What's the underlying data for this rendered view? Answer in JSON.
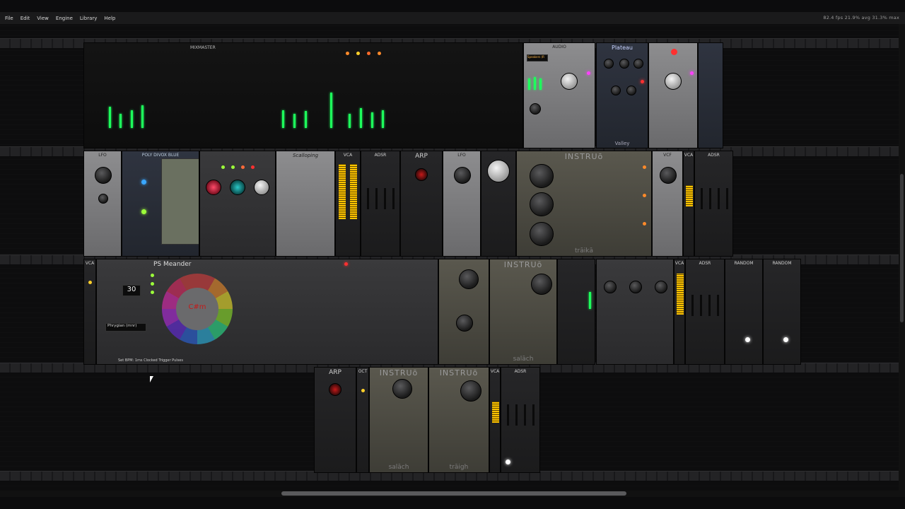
{
  "menu": {
    "items": [
      "File",
      "Edit",
      "View",
      "Engine",
      "Library",
      "Help"
    ]
  },
  "status": {
    "perf": "82.4 fps   21.9% avg   31.3% max"
  },
  "modules": {
    "mixer": {
      "label": "MIXMASTER"
    },
    "audio": {
      "label": "AUDIO",
      "device": "Speakers (R"
    },
    "plateau": {
      "label": "Plateau",
      "footer": "Valley"
    },
    "lfo": {
      "label": "LFO"
    },
    "poly": {
      "label": "POLY DIVOX BLUE"
    },
    "synth": {
      "label": "Scalloping"
    },
    "vca1": {
      "label": "VCA"
    },
    "vca2": {
      "label": "VCA"
    },
    "adsr1": {
      "label": "ADSR"
    },
    "arp": {
      "label": "ARP"
    },
    "lfo2": {
      "label": "LFO"
    },
    "instruo1": {
      "label": "INSTRUō",
      "footer": "trāikā"
    },
    "vcf": {
      "label": "VCF"
    },
    "vca3": {
      "label": "VCA"
    },
    "adsr2": {
      "label": "ADSR"
    },
    "meander": {
      "title": "PS Meander",
      "key": "C#m",
      "bpm": "30",
      "mode": "Phrygian (mnr)",
      "footer": "Set BPM: 1ms Clocked Trigger Pulses"
    },
    "instruo2": {
      "label": "INSTRUō",
      "footer": "salāch"
    },
    "instruo3": {
      "label": "INSTRUō",
      "footer": "trāigh"
    },
    "vca4": {
      "label": "VCA"
    },
    "adsr3": {
      "label": "ADSR"
    },
    "random1": {
      "label": "RANDOM"
    },
    "random2": {
      "label": "RANDOM"
    },
    "arp2": {
      "label": "ARP"
    },
    "oct": {
      "label": "OCT"
    },
    "instruo4": {
      "label": "INSTRUō",
      "footer": "salāch"
    },
    "instruo5": {
      "label": "INSTRUō",
      "footer": "trāigh"
    },
    "vca5": {
      "label": "VCA"
    },
    "adsr4": {
      "label": "ADSR"
    }
  },
  "colors": {
    "accent_green": "#1dff5c",
    "led_yellow": "#e8e040",
    "led_red": "#ff3030",
    "bg": "#0c0c0d"
  }
}
